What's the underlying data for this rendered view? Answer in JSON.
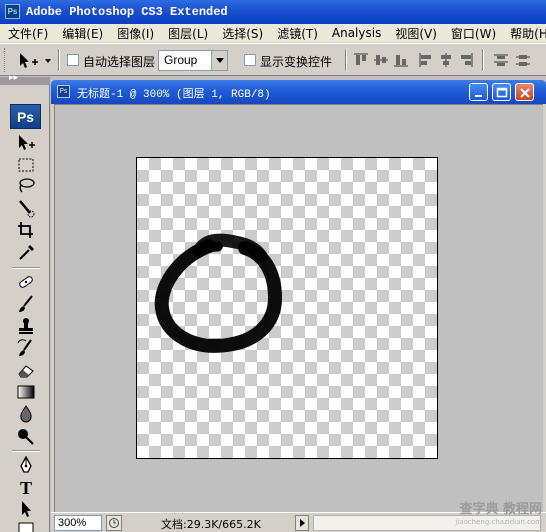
{
  "app": {
    "title": "Adobe Photoshop CS3 Extended",
    "logo_text": "Ps"
  },
  "menu": [
    {
      "label": "文件(F)"
    },
    {
      "label": "编辑(E)"
    },
    {
      "label": "图像(I)"
    },
    {
      "label": "图层(L)"
    },
    {
      "label": "选择(S)"
    },
    {
      "label": "滤镜(T)"
    },
    {
      "label": "Analysis"
    },
    {
      "label": "视图(V)"
    },
    {
      "label": "窗口(W)"
    },
    {
      "label": "帮助(H)"
    }
  ],
  "options": {
    "auto_select_label": "自动选择图层",
    "auto_select_checked": false,
    "group_value": "Group",
    "show_transform_label": "显示变换控件",
    "show_transform_checked": false
  },
  "toolbox": {
    "logo": "Ps",
    "tools": [
      "move-tool-icon",
      "marquee-tool-icon",
      "lasso-tool-icon",
      "quick-selection-tool-icon",
      "crop-tool-icon",
      "eyedropper-tool-icon",
      "healing-brush-tool-icon",
      "brush-tool-icon",
      "clone-stamp-tool-icon",
      "history-brush-tool-icon",
      "eraser-tool-icon",
      "gradient-tool-icon",
      "blur-tool-icon",
      "dodge-tool-icon",
      "pen-tool-icon",
      "type-tool-icon",
      "path-selection-tool-icon"
    ]
  },
  "document": {
    "title": "无标题-1 @ 300% (图层 1, RGB/8)",
    "icon_text": "Ps"
  },
  "status": {
    "zoom": "300%",
    "doc_info": "文档:29.3K/665.2K"
  },
  "watermark": {
    "text": "查字典 教程网",
    "sub": "jiaocheng.chazidian.com"
  }
}
